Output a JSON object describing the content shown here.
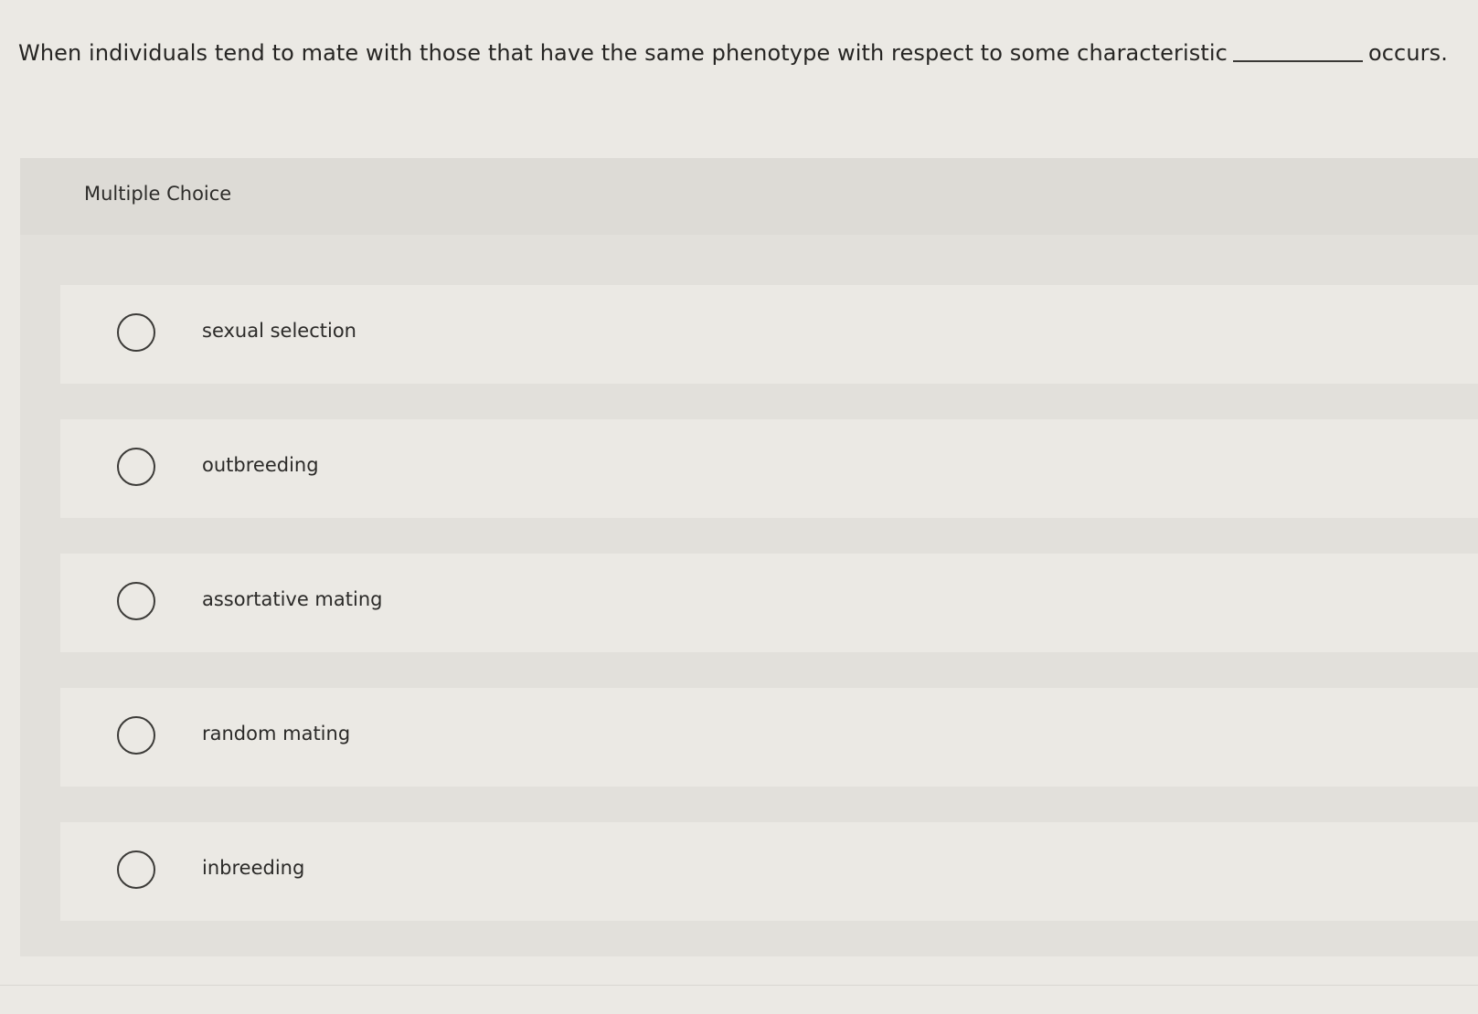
{
  "question": {
    "text_before": "When individuals tend to mate with those that have the same phenotype with respect to some characteristic",
    "text_after": "occurs."
  },
  "multiple_choice": {
    "title": "Multiple Choice",
    "options": [
      {
        "label": "sexual selection"
      },
      {
        "label": "outbreeding"
      },
      {
        "label": "assortative mating"
      },
      {
        "label": "random mating"
      },
      {
        "label": "inbreeding"
      }
    ]
  }
}
